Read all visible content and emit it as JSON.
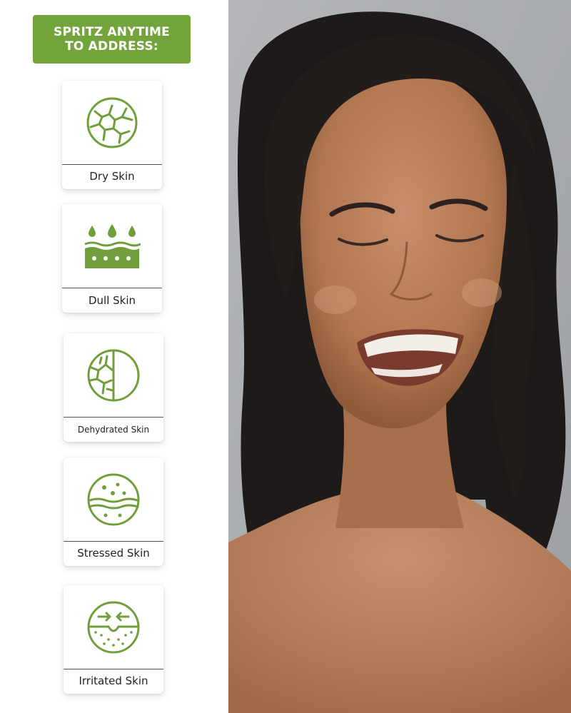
{
  "banner": {
    "title": "SPRITZ ANYTIME\nTO ADDRESS:"
  },
  "colors": {
    "brand_green": "#73A33B",
    "icon_green": "#6F9E3A",
    "text": "#222222",
    "photo_bg": "#A6A9AD"
  },
  "concerns": [
    {
      "label": "Dry Skin",
      "icon": "cracked-skin-circle-icon"
    },
    {
      "label": "Dull Skin",
      "icon": "skin-layer-droplets-icon"
    },
    {
      "label": "Dehydrated Skin",
      "icon": "half-cracked-circle-icon"
    },
    {
      "label": "Stressed Skin",
      "icon": "skin-layers-dots-circle-icon"
    },
    {
      "label": "Irritated Skin",
      "icon": "skin-pores-arrows-circle-icon"
    }
  ],
  "photo": {
    "subject": "smiling-woman-portrait"
  }
}
